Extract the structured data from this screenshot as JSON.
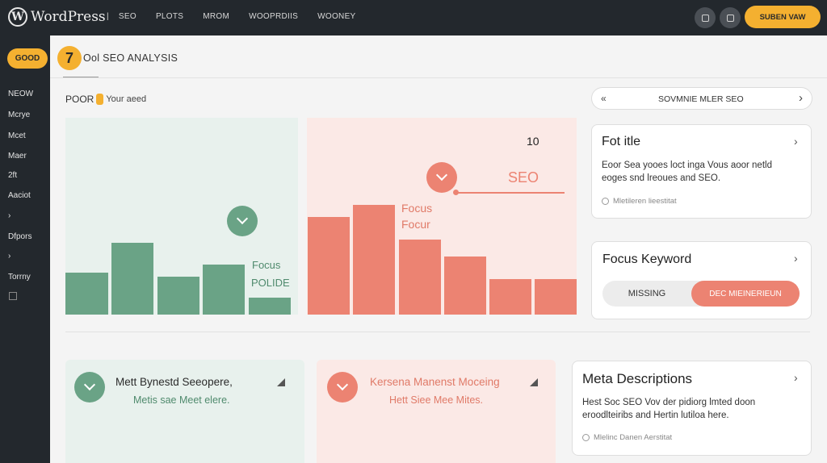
{
  "topbar": {
    "logo_glyph": "W",
    "brand": "WordPress",
    "separator": "|",
    "nav": [
      "SEO",
      "PLOTS",
      "MROM",
      "WOOPRDIIS",
      "WOONEY"
    ],
    "view_button": "SUBEN VAW"
  },
  "sidebar": {
    "badge": "GOOD",
    "items": [
      "NEOW",
      "Mcrye",
      "Mcet",
      "Maer",
      "2ft",
      "Aaciot",
      "›",
      "Dfpors",
      "›",
      "Torrny"
    ]
  },
  "header": {
    "score": "7",
    "title": "Ool SEO ANALYSIS"
  },
  "poor": {
    "label": "POOR",
    "sub": "Your aeed"
  },
  "green_panel": {
    "label_line1": "Focus",
    "label_line2": "POLIDE",
    "accent": "#6aa386"
  },
  "red_panel": {
    "number": "10",
    "seo_label": "SEO",
    "focus_line1": "Focus",
    "focus_line2": "Focur",
    "accent": "#ec8372"
  },
  "search": {
    "icon_text": "«",
    "label": "SOVMNIE MLER SEO",
    "chevron": "›"
  },
  "card_title": {
    "title": "Fot itle",
    "chevron": "›",
    "body_line1": "Eoor Sea yooes loct inga Vous aoor netld",
    "body_line2": "eoges snd lreoues and SEO.",
    "meta": "Mletileren lieestitat"
  },
  "card_keyword": {
    "title": "Focus Keyword",
    "chevron": "›",
    "toggle_left": "MISSING",
    "toggle_right": "DEC MIEINERIEUN"
  },
  "card_meta": {
    "title": "Meta Descriptions",
    "chevron": "›",
    "body_line1": "Hest Soc SEO Vov der pidiorg lmted doon",
    "body_line2": "eroodlteiribs and Hertin lutiloa here.",
    "meta": "Mlelinc Danen Aerstitat"
  },
  "bottom_green": {
    "line1": "Mett Bynestd Seeopere,",
    "line2": "Metis sae Meet elere."
  },
  "bottom_red": {
    "line1": "Kersena Manenst Moceing",
    "line2": "Hett Siee Mee Mites."
  }
}
